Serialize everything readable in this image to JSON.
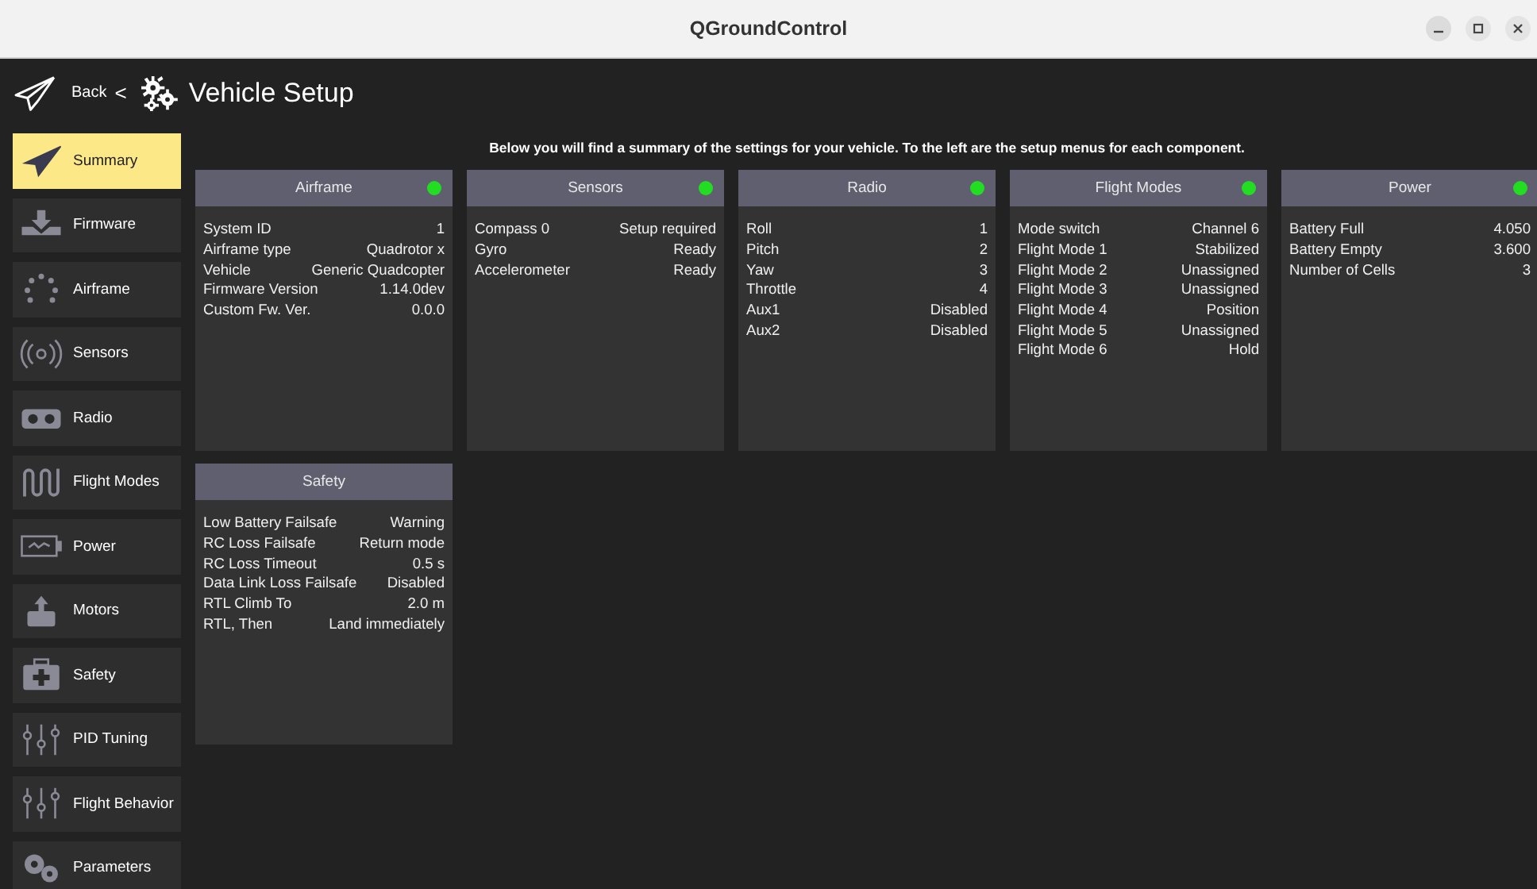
{
  "window": {
    "title": "QGroundControl"
  },
  "header": {
    "back": "Back",
    "separator": "<",
    "title": "Vehicle Setup"
  },
  "sidebar": {
    "items": [
      {
        "label": "Summary",
        "selected": true
      },
      {
        "label": "Firmware",
        "selected": false
      },
      {
        "label": "Airframe",
        "selected": false
      },
      {
        "label": "Sensors",
        "selected": false
      },
      {
        "label": "Radio",
        "selected": false
      },
      {
        "label": "Flight Modes",
        "selected": false
      },
      {
        "label": "Power",
        "selected": false
      },
      {
        "label": "Motors",
        "selected": false
      },
      {
        "label": "Safety",
        "selected": false
      },
      {
        "label": "PID Tuning",
        "selected": false
      },
      {
        "label": "Flight Behavior",
        "selected": false
      },
      {
        "label": "Parameters",
        "selected": false
      }
    ]
  },
  "intro": "Below you will find a summary of the settings for your vehicle. To the left are the setup menus for each component.",
  "cards": [
    {
      "title": "Airframe",
      "status_dot": true,
      "rows": [
        [
          "System ID",
          "1"
        ],
        [
          "Airframe type",
          "Quadrotor x"
        ],
        [
          "Vehicle",
          "Generic Quadcopter"
        ],
        [
          "Firmware Version",
          "1.14.0dev"
        ],
        [
          "Custom Fw. Ver.",
          "0.0.0"
        ]
      ]
    },
    {
      "title": "Sensors",
      "status_dot": true,
      "rows": [
        [
          "Compass 0",
          "Setup required"
        ],
        [
          "Gyro",
          "Ready"
        ],
        [
          "Accelerometer",
          "Ready"
        ]
      ]
    },
    {
      "title": "Radio",
      "status_dot": true,
      "rows": [
        [
          "Roll",
          "1"
        ],
        [
          "Pitch",
          "2"
        ],
        [
          "Yaw",
          "3"
        ],
        [
          "Throttle",
          "4"
        ],
        [
          "Aux1",
          "Disabled"
        ],
        [
          "Aux2",
          "Disabled"
        ]
      ]
    },
    {
      "title": "Flight Modes",
      "status_dot": true,
      "rows": [
        [
          "Mode switch",
          "Channel 6"
        ],
        [
          "Flight Mode 1",
          "Stabilized"
        ],
        [
          "Flight Mode 2",
          "Unassigned"
        ],
        [
          "Flight Mode 3",
          "Unassigned"
        ],
        [
          "Flight Mode 4",
          "Position"
        ],
        [
          "Flight Mode 5",
          "Unassigned"
        ],
        [
          "Flight Mode 6",
          "Hold"
        ]
      ]
    },
    {
      "title": "Power",
      "status_dot": true,
      "rows": [
        [
          "Battery Full",
          "4.050"
        ],
        [
          "Battery Empty",
          "3.600"
        ],
        [
          "Number of Cells",
          "3"
        ]
      ]
    },
    {
      "title": "Safety",
      "status_dot": false,
      "rows": [
        [
          "Low Battery Failsafe",
          "Warning"
        ],
        [
          "RC Loss Failsafe",
          "Return mode"
        ],
        [
          "RC Loss Timeout",
          "0.5 s"
        ],
        [
          "Data Link Loss Failsafe",
          "Disabled"
        ],
        [
          "RTL Climb To",
          "2.0 m"
        ],
        [
          "RTL, Then",
          "Land immediately"
        ]
      ]
    }
  ]
}
